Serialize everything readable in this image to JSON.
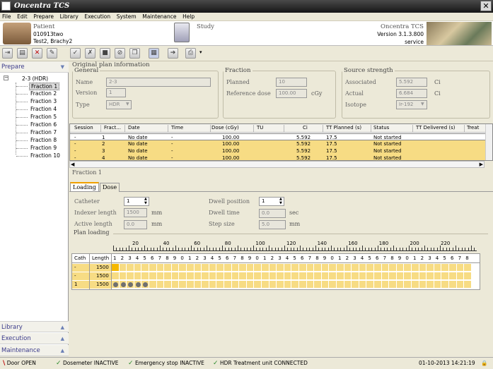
{
  "window": {
    "title": "Oncentra TCS",
    "close_glyph": "✕"
  },
  "menu": [
    "File",
    "Edit",
    "Prepare",
    "Library",
    "Execution",
    "System",
    "Maintenance",
    "Help"
  ],
  "header": {
    "patient_label": "Patient",
    "patient_id": "010913two",
    "patient_name": "Test2, Brachy2",
    "study_label": "Study",
    "product": "Oncentra TCS",
    "version": "Version 3.1.3.800",
    "user": "service"
  },
  "left": {
    "prepare_label": "Prepare",
    "tree_root": "2-3 (HDR)",
    "fractions": [
      "Fraction 1",
      "Fraction 2",
      "Fraction 3",
      "Fraction 4",
      "Fraction 5",
      "Fraction 6",
      "Fraction 7",
      "Fraction 8",
      "Fraction 9",
      "Fraction 10"
    ],
    "bottom": [
      "Library",
      "Execution",
      "Maintenance"
    ]
  },
  "plan": {
    "title": "Original plan information",
    "general": {
      "legend": "General",
      "name_label": "Name",
      "name": "2-3",
      "version_label": "Version",
      "version": "1",
      "type_label": "Type",
      "type": "HDR"
    },
    "fraction": {
      "legend": "Fraction",
      "planned_label": "Planned",
      "planned": "10",
      "refdose_label": "Reference dose",
      "refdose": "100.00",
      "refdose_unit": "cGy"
    },
    "source": {
      "legend": "Source strength",
      "assoc_label": "Associated",
      "assoc": "5.592",
      "assoc_unit": "Ci",
      "actual_label": "Actual",
      "actual": "6.684",
      "actual_unit": "Ci",
      "isotope_label": "Isotope",
      "isotope": "Ir-192"
    }
  },
  "sessions": {
    "columns": [
      "Session",
      "Fract...",
      "Date",
      "Time",
      "Dose (cGy)",
      "TU",
      "Ci",
      "TT Planned (s)",
      "Status",
      "TT Delivered (s)",
      "Treat"
    ],
    "rows": [
      [
        "-",
        "1",
        "No date",
        "-",
        "100.00",
        "",
        "5.592",
        "17.5",
        "Not started",
        "",
        ""
      ],
      [
        "-",
        "2",
        "No date",
        "-",
        "100.00",
        "",
        "5.592",
        "17.5",
        "Not started",
        "",
        ""
      ],
      [
        "-",
        "3",
        "No date",
        "-",
        "100.00",
        "",
        "5.592",
        "17.5",
        "Not started",
        "",
        ""
      ],
      [
        "-",
        "4",
        "No date",
        "-",
        "100.00",
        "",
        "5.592",
        "17.5",
        "Not started",
        "",
        ""
      ]
    ]
  },
  "fraction_panel": {
    "title": "Fraction 1",
    "tabs": [
      "Loading",
      "Dose"
    ],
    "catheter_label": "Catheter",
    "catheter": "1",
    "indexer_label": "Indexer length",
    "indexer": "1500",
    "indexer_unit": "mm",
    "active_label": "Active length",
    "active": "0.0",
    "active_unit": "mm",
    "dwellpos_label": "Dwell position",
    "dwellpos": "1",
    "dwelltime_label": "Dwell time",
    "dwelltime": "0.0",
    "dwelltime_unit": "sec",
    "step_label": "Step size",
    "step": "5.0",
    "step_unit": "mm",
    "plan_loading_label": "Plan loading",
    "ruler": [
      "20",
      "40",
      "60",
      "80",
      "100",
      "120",
      "140",
      "160",
      "180",
      "200",
      "220"
    ],
    "cath_header": "Cath",
    "length_header": "Length",
    "pos_digits": [
      "1",
      "2",
      "3",
      "4",
      "5",
      "6",
      "7",
      "8",
      "9",
      "0",
      "1",
      "2",
      "3",
      "4",
      "5",
      "6",
      "7",
      "8",
      "9",
      "0",
      "1",
      "2",
      "3",
      "4",
      "5",
      "6",
      "7",
      "8",
      "9",
      "0",
      "1",
      "2",
      "3",
      "4",
      "5",
      "6",
      "7",
      "8",
      "9",
      "0",
      "1",
      "2",
      "3",
      "4",
      "5",
      "6",
      "7",
      "8"
    ],
    "cath_rows": [
      {
        "cath": "-",
        "length": "1500",
        "dots": 0
      },
      {
        "cath": "-",
        "length": "1500",
        "dots": 0
      },
      {
        "cath": "1",
        "length": "1500",
        "dots": 5
      }
    ]
  },
  "status": {
    "door": "Door OPEN",
    "dosimeter": "Dosemeter INACTIVE",
    "emergency": "Emergency stop INACTIVE",
    "hdr": "HDR Treatment unit CONNECTED",
    "date": "01-10-2013",
    "time": "14:21:19"
  },
  "colors": {
    "highlight": "#f7dc84",
    "selected": "#f5b800",
    "dot": "#707070"
  }
}
